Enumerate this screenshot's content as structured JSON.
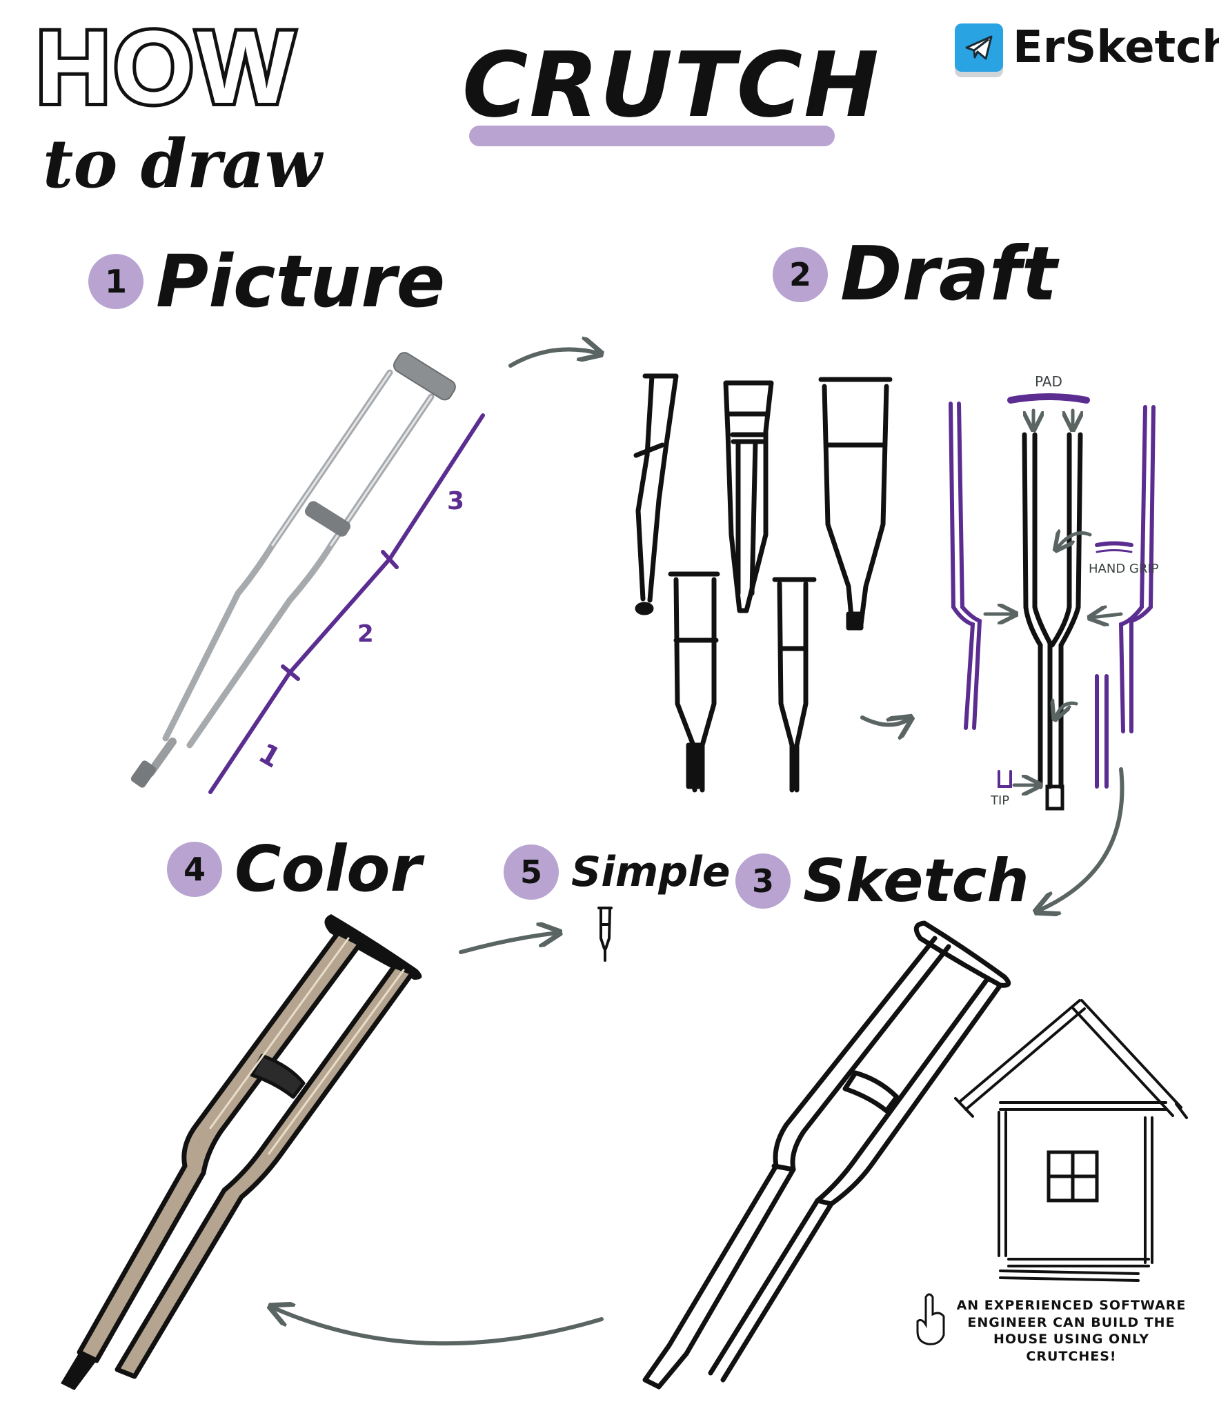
{
  "header": {
    "how": "HOW",
    "to_draw": "to draw",
    "title": "CRUTCH",
    "brand": "ErSketch"
  },
  "steps": [
    {
      "num": "1",
      "title": "Picture"
    },
    {
      "num": "2",
      "title": "Draft"
    },
    {
      "num": "3",
      "title": "Sketch"
    },
    {
      "num": "4",
      "title": "Color"
    },
    {
      "num": "5",
      "title": "Simple"
    }
  ],
  "picture_marks": [
    "1",
    "2",
    "3"
  ],
  "draft_labels": {
    "pad": "PAD",
    "hand_grip": "HAND GRIP",
    "tip": "TIP"
  },
  "note": "AN EXPERIENCED SOFTWARE ENGINEER CAN BUILD THE HOUSE USING ONLY CRUTCHES!",
  "colors": {
    "accent_purple": "#b8a3d1",
    "guide_purple": "#5b2d91",
    "arrow_gray": "#5a6563",
    "crutch_color": "#b5a590",
    "brand_blue": "#2aa3e3"
  }
}
